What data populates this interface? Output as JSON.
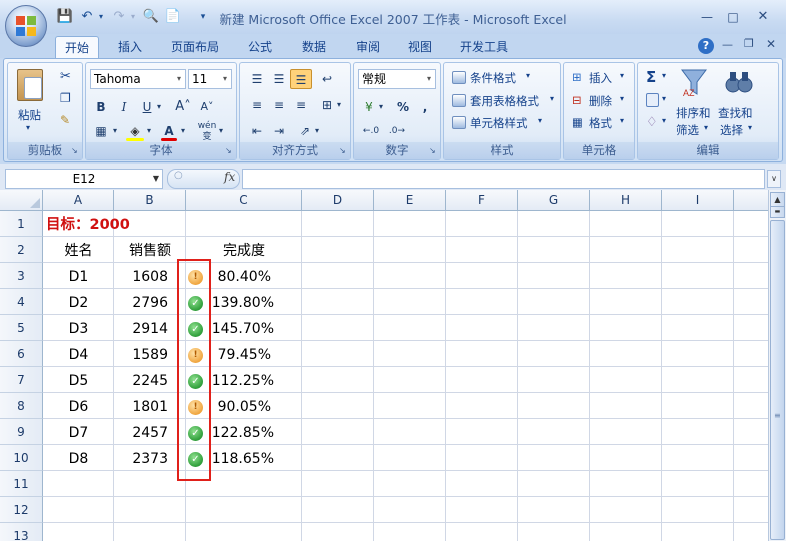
{
  "window": {
    "title": "新建 Microsoft Office Excel 2007 工作表 - Microsoft Excel",
    "quick_access": [
      "save-icon",
      "undo-icon",
      "redo-icon",
      "print-preview-icon",
      "new-icon",
      "customize-icon"
    ]
  },
  "tabs": [
    "开始",
    "插入",
    "页面布局",
    "公式",
    "数据",
    "审阅",
    "视图",
    "开发工具"
  ],
  "active_tab": "开始",
  "ribbon": {
    "clipboard": {
      "label": "剪贴板",
      "paste": "粘贴"
    },
    "font": {
      "label": "字体",
      "name": "Tahoma",
      "size": "11",
      "bold": "B",
      "italic": "I",
      "underline": "U",
      "wen": "wén"
    },
    "alignment": {
      "label": "对齐方式"
    },
    "number": {
      "label": "数字",
      "format": "常规",
      "percent": "%",
      "comma": ","
    },
    "styles": {
      "label": "样式",
      "cond": "条件格式",
      "table": "套用表格格式",
      "cell": "单元格样式"
    },
    "cells": {
      "label": "单元格",
      "insert": "插入",
      "delete": "删除",
      "format": "格式"
    },
    "editing": {
      "label": "编辑",
      "sigma": "Σ",
      "sort_line1": "排序和",
      "sort_line2": "筛选",
      "find_line1": "查找和",
      "find_line2": "选择"
    }
  },
  "formula_bar": {
    "name_box": "E12",
    "fx": "fx",
    "value": ""
  },
  "columns": [
    "A",
    "B",
    "C",
    "D",
    "E",
    "F",
    "G",
    "H",
    "I"
  ],
  "rows": [
    "1",
    "2",
    "3",
    "4",
    "5",
    "6",
    "7",
    "8",
    "9",
    "10",
    "11",
    "12",
    "13"
  ],
  "sheet": {
    "target": "目标：2000",
    "headers": {
      "name": "姓名",
      "sales": "销售额",
      "completion": "完成度"
    },
    "data": [
      {
        "name": "D1",
        "sales": "1608",
        "completion": "80.40%",
        "status": "warn"
      },
      {
        "name": "D2",
        "sales": "2796",
        "completion": "139.80%",
        "status": "ok"
      },
      {
        "name": "D3",
        "sales": "2914",
        "completion": "145.70%",
        "status": "ok"
      },
      {
        "name": "D4",
        "sales": "1589",
        "completion": "79.45%",
        "status": "warn"
      },
      {
        "name": "D5",
        "sales": "2245",
        "completion": "112.25%",
        "status": "ok"
      },
      {
        "name": "D6",
        "sales": "1801",
        "completion": "90.05%",
        "status": "warn"
      },
      {
        "name": "D7",
        "sales": "2457",
        "completion": "122.85%",
        "status": "ok"
      },
      {
        "name": "D8",
        "sales": "2373",
        "completion": "118.65%",
        "status": "ok"
      }
    ]
  },
  "colors": {
    "target_text": "#d01010",
    "highlight_border": "#e0201a",
    "ok": "#2f9e3a",
    "warn": "#f0a640"
  }
}
